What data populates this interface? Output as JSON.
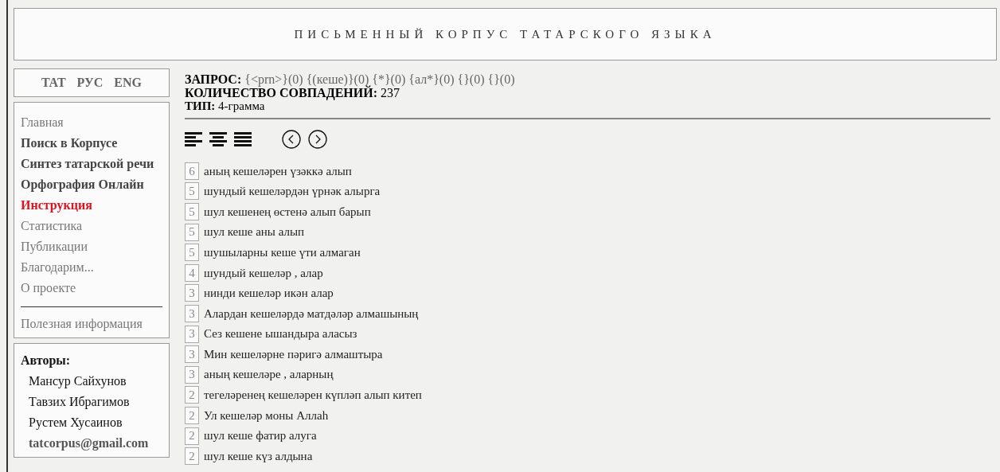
{
  "header": {
    "title": "ПИСЬМЕННЫЙ КОРПУС ТАТАРСКОГО ЯЗЫКА"
  },
  "languages": [
    "TAT",
    "РУС",
    "ENG"
  ],
  "nav": [
    {
      "label": "Главная",
      "bold": false,
      "selected": false
    },
    {
      "label": "Поиск в Корпусе",
      "bold": true,
      "selected": false
    },
    {
      "label": "Синтез татарской речи",
      "bold": true,
      "selected": false
    },
    {
      "label": "Орфография Онлайн",
      "bold": true,
      "selected": false
    },
    {
      "label": "Инструкция",
      "bold": true,
      "selected": true
    },
    {
      "label": "Статистика",
      "bold": false,
      "selected": false
    },
    {
      "label": "Публикации",
      "bold": false,
      "selected": false
    },
    {
      "label": "Благодарим...",
      "bold": false,
      "selected": false
    },
    {
      "label": "О проекте",
      "bold": false,
      "selected": false
    }
  ],
  "extra_links": [
    "Полезная информация"
  ],
  "authors": {
    "title": "Авторы:",
    "names": [
      "Мансур Сайхунов",
      "Тавзих Ибрагимов",
      "Рустем Хусаинов"
    ],
    "email": "tatcorpus@gmail.com"
  },
  "query": {
    "label": "ЗАПРОС:",
    "value": "{<prn>}(0) {(кеше)}(0) {*}(0) {ал*}(0) {}(0) {}(0)",
    "count_label": "КОЛИЧЕСТВО СОВПАДЕНИЙ:",
    "count": "237",
    "type_label": "ТИП:",
    "type": "4-грамма"
  },
  "results": [
    {
      "count": "6",
      "text": "аның кешеләрен үзәккә алып"
    },
    {
      "count": "5",
      "text": "шундый кешеләрдән үрнәк алырга"
    },
    {
      "count": "5",
      "text": "шул кешенең өстенә алып барып"
    },
    {
      "count": "5",
      "text": "шул кеше аны алып"
    },
    {
      "count": "5",
      "text": "шушыларны кеше үти алмаган"
    },
    {
      "count": "4",
      "text": "шундый кешеләр , алар"
    },
    {
      "count": "3",
      "text": "нинди кешеләр икән алар"
    },
    {
      "count": "3",
      "text": "Алардан кешеләрдә матдәләр алмашының"
    },
    {
      "count": "3",
      "text": "Сез кешене ышандыра аласыз"
    },
    {
      "count": "3",
      "text": "Мин кешеләрне пәригә алмаштыра"
    },
    {
      "count": "3",
      "text": "аның кешеләре , аларның"
    },
    {
      "count": "2",
      "text": "тегеләренең кешеләрен күпләп алып китеп"
    },
    {
      "count": "2",
      "text": "Ул кешеләр моны Аллаһ"
    },
    {
      "count": "2",
      "text": "шул кеше фатир алуга"
    },
    {
      "count": "2",
      "text": "шул кеше күз алдына"
    }
  ]
}
